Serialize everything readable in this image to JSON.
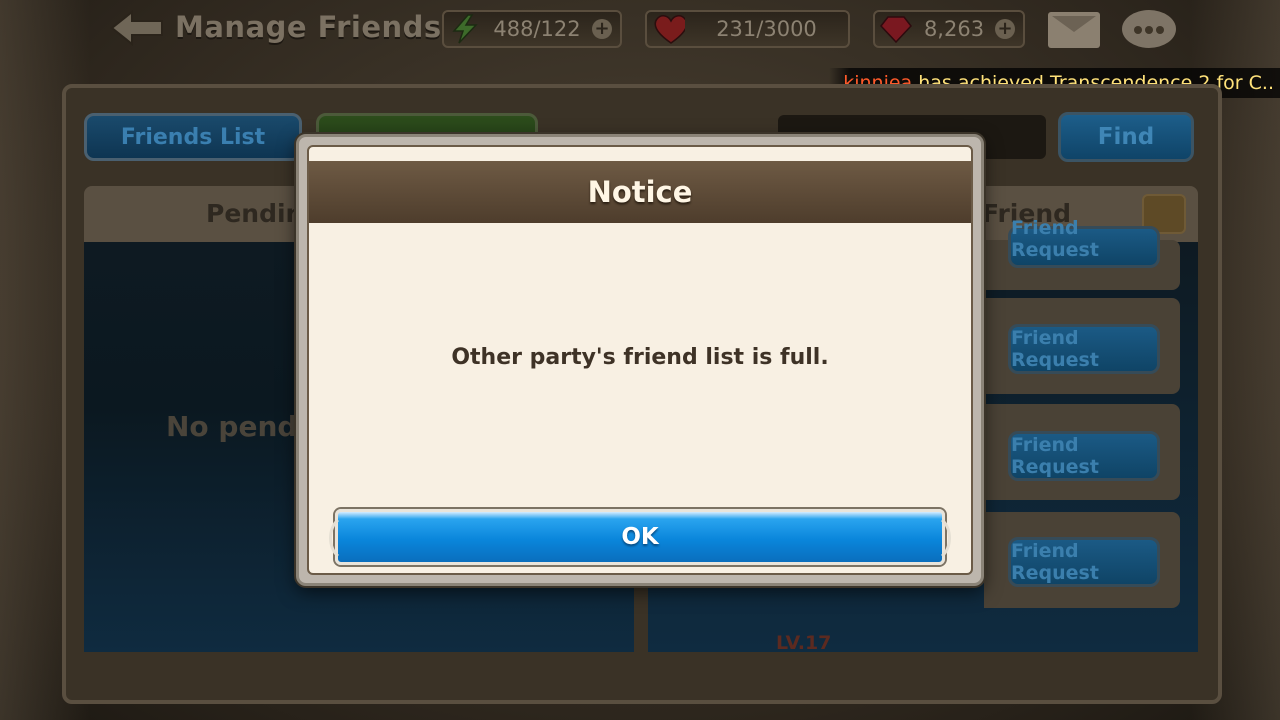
{
  "header": {
    "title": "Manage Friends",
    "energy": "488/122",
    "hearts": "231/3000",
    "gems": "8,263"
  },
  "ticker": {
    "player": "kinniea",
    "message": "has achieved Transcendence 2 for C.."
  },
  "background": {
    "tabs": {
      "friends_list": "Friends List"
    },
    "find_label": "Find",
    "pending_header": "Pendin",
    "pending_empty": "No pendi",
    "recommend_header": "Friend",
    "request_label": "Friend Request",
    "request_label_partial": "Friend Request",
    "level_text": "LV.17"
  },
  "modal": {
    "title": "Notice",
    "message": "Other party's friend list is full.",
    "ok_label": "OK"
  },
  "colors": {
    "accent_blue": "#0a86db",
    "modal_bg": "#f8f0e3",
    "header_brown": "#5e4a36"
  }
}
